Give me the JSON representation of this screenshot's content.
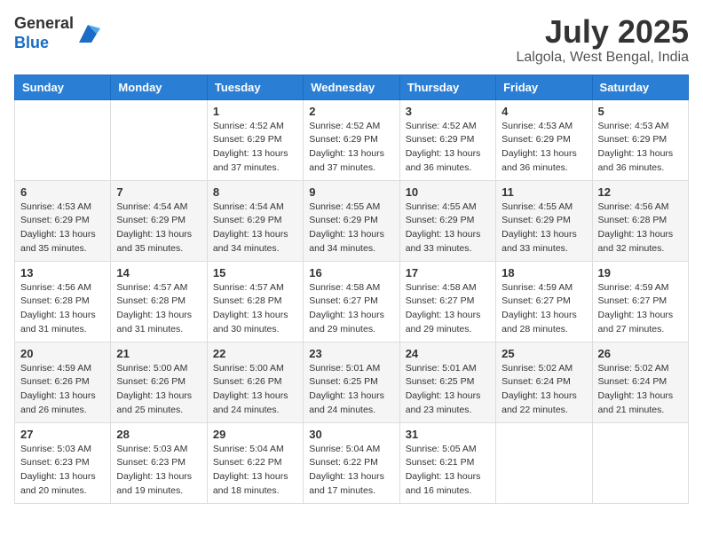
{
  "logo": {
    "general": "General",
    "blue": "Blue"
  },
  "title": "July 2025",
  "location": "Lalgola, West Bengal, India",
  "days_of_week": [
    "Sunday",
    "Monday",
    "Tuesday",
    "Wednesday",
    "Thursday",
    "Friday",
    "Saturday"
  ],
  "weeks": [
    [
      null,
      null,
      {
        "day": 1,
        "sunrise": "4:52 AM",
        "sunset": "6:29 PM",
        "daylight": "13 hours and 37 minutes."
      },
      {
        "day": 2,
        "sunrise": "4:52 AM",
        "sunset": "6:29 PM",
        "daylight": "13 hours and 37 minutes."
      },
      {
        "day": 3,
        "sunrise": "4:52 AM",
        "sunset": "6:29 PM",
        "daylight": "13 hours and 36 minutes."
      },
      {
        "day": 4,
        "sunrise": "4:53 AM",
        "sunset": "6:29 PM",
        "daylight": "13 hours and 36 minutes."
      },
      {
        "day": 5,
        "sunrise": "4:53 AM",
        "sunset": "6:29 PM",
        "daylight": "13 hours and 36 minutes."
      }
    ],
    [
      {
        "day": 6,
        "sunrise": "4:53 AM",
        "sunset": "6:29 PM",
        "daylight": "13 hours and 35 minutes."
      },
      {
        "day": 7,
        "sunrise": "4:54 AM",
        "sunset": "6:29 PM",
        "daylight": "13 hours and 35 minutes."
      },
      {
        "day": 8,
        "sunrise": "4:54 AM",
        "sunset": "6:29 PM",
        "daylight": "13 hours and 34 minutes."
      },
      {
        "day": 9,
        "sunrise": "4:55 AM",
        "sunset": "6:29 PM",
        "daylight": "13 hours and 34 minutes."
      },
      {
        "day": 10,
        "sunrise": "4:55 AM",
        "sunset": "6:29 PM",
        "daylight": "13 hours and 33 minutes."
      },
      {
        "day": 11,
        "sunrise": "4:55 AM",
        "sunset": "6:29 PM",
        "daylight": "13 hours and 33 minutes."
      },
      {
        "day": 12,
        "sunrise": "4:56 AM",
        "sunset": "6:28 PM",
        "daylight": "13 hours and 32 minutes."
      }
    ],
    [
      {
        "day": 13,
        "sunrise": "4:56 AM",
        "sunset": "6:28 PM",
        "daylight": "13 hours and 31 minutes."
      },
      {
        "day": 14,
        "sunrise": "4:57 AM",
        "sunset": "6:28 PM",
        "daylight": "13 hours and 31 minutes."
      },
      {
        "day": 15,
        "sunrise": "4:57 AM",
        "sunset": "6:28 PM",
        "daylight": "13 hours and 30 minutes."
      },
      {
        "day": 16,
        "sunrise": "4:58 AM",
        "sunset": "6:27 PM",
        "daylight": "13 hours and 29 minutes."
      },
      {
        "day": 17,
        "sunrise": "4:58 AM",
        "sunset": "6:27 PM",
        "daylight": "13 hours and 29 minutes."
      },
      {
        "day": 18,
        "sunrise": "4:59 AM",
        "sunset": "6:27 PM",
        "daylight": "13 hours and 28 minutes."
      },
      {
        "day": 19,
        "sunrise": "4:59 AM",
        "sunset": "6:27 PM",
        "daylight": "13 hours and 27 minutes."
      }
    ],
    [
      {
        "day": 20,
        "sunrise": "4:59 AM",
        "sunset": "6:26 PM",
        "daylight": "13 hours and 26 minutes."
      },
      {
        "day": 21,
        "sunrise": "5:00 AM",
        "sunset": "6:26 PM",
        "daylight": "13 hours and 25 minutes."
      },
      {
        "day": 22,
        "sunrise": "5:00 AM",
        "sunset": "6:26 PM",
        "daylight": "13 hours and 24 minutes."
      },
      {
        "day": 23,
        "sunrise": "5:01 AM",
        "sunset": "6:25 PM",
        "daylight": "13 hours and 24 minutes."
      },
      {
        "day": 24,
        "sunrise": "5:01 AM",
        "sunset": "6:25 PM",
        "daylight": "13 hours and 23 minutes."
      },
      {
        "day": 25,
        "sunrise": "5:02 AM",
        "sunset": "6:24 PM",
        "daylight": "13 hours and 22 minutes."
      },
      {
        "day": 26,
        "sunrise": "5:02 AM",
        "sunset": "6:24 PM",
        "daylight": "13 hours and 21 minutes."
      }
    ],
    [
      {
        "day": 27,
        "sunrise": "5:03 AM",
        "sunset": "6:23 PM",
        "daylight": "13 hours and 20 minutes."
      },
      {
        "day": 28,
        "sunrise": "5:03 AM",
        "sunset": "6:23 PM",
        "daylight": "13 hours and 19 minutes."
      },
      {
        "day": 29,
        "sunrise": "5:04 AM",
        "sunset": "6:22 PM",
        "daylight": "13 hours and 18 minutes."
      },
      {
        "day": 30,
        "sunrise": "5:04 AM",
        "sunset": "6:22 PM",
        "daylight": "13 hours and 17 minutes."
      },
      {
        "day": 31,
        "sunrise": "5:05 AM",
        "sunset": "6:21 PM",
        "daylight": "13 hours and 16 minutes."
      },
      null,
      null
    ]
  ],
  "labels": {
    "sunrise": "Sunrise:",
    "sunset": "Sunset:",
    "daylight": "Daylight:"
  }
}
